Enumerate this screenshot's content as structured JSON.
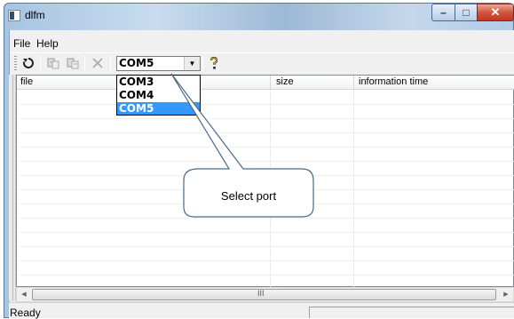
{
  "window": {
    "title": "dlfm",
    "minimize": "–",
    "maximize": "□",
    "close": "✕"
  },
  "menu": {
    "items": [
      "File",
      "Help"
    ]
  },
  "toolbar": {
    "icons": [
      "refresh-icon",
      "copy-to-device-icon",
      "copy-from-device-icon",
      "delete-icon",
      "help-icon"
    ],
    "port_combo": {
      "value": "COM5",
      "options": [
        "COM3",
        "COM4",
        "COM5"
      ],
      "selected_index": 2
    }
  },
  "list": {
    "columns": [
      "file",
      "size",
      "information time"
    ]
  },
  "callout": {
    "text": "Select port"
  },
  "scrollbar": {
    "left_arrow": "◀",
    "right_arrow": "▶",
    "grip": "III"
  },
  "status": {
    "text": "Ready"
  },
  "colors": {
    "selection": "#3399ff",
    "close_button": "#c2371e",
    "callout_stroke": "#4a6a8a"
  }
}
